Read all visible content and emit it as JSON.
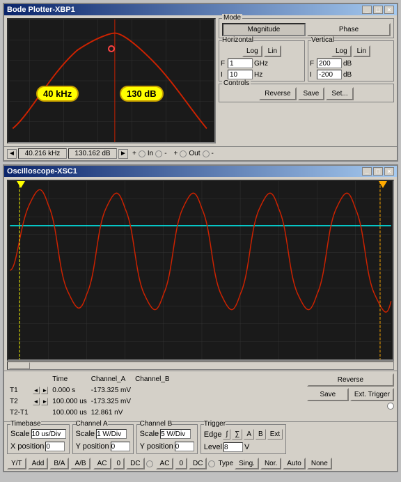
{
  "bode": {
    "title": "Bode Plotter-XBP1",
    "labels": {
      "freq": "40 kHz",
      "db": "130 dB"
    },
    "mode": {
      "label": "Mode",
      "magnitude": "Magnitude",
      "phase": "Phase"
    },
    "horizontal": {
      "label": "Horizontal",
      "log": "Log",
      "lin": "Lin",
      "f_label": "F",
      "f_value": "1",
      "f_unit": "GHz",
      "i_label": "I",
      "i_value": "10",
      "i_unit": "Hz"
    },
    "vertical": {
      "label": "Vertical",
      "log": "Log",
      "lin": "Lin",
      "f_label": "F",
      "f_value": "200",
      "f_unit": "dB",
      "i_label": "I",
      "i_value": "-200",
      "i_unit": "dB"
    },
    "controls": {
      "label": "Controls",
      "reverse": "Reverse",
      "save": "Save",
      "set": "Set..."
    },
    "status": {
      "freq": "40.216 kHz",
      "db": "130.162 dB",
      "in_label": "+ C In C -",
      "out_label": "+ C Out C -"
    }
  },
  "osc": {
    "title": "Oscilloscope-XSC1",
    "measurements": {
      "t1_label": "T1",
      "t2_label": "T2",
      "t2t1_label": "T2-T1",
      "time_header": "Time",
      "cha_header": "Channel_A",
      "chb_header": "Channel_B",
      "t1_time": "0.000 s",
      "t1_cha": "-173.325 mV",
      "t2_time": "100.000 us",
      "t2_cha": "-173.325 mV",
      "t2t1_time": "100.000 us",
      "t2t1_cha": "12.861 nV"
    },
    "buttons": {
      "reverse": "Reverse",
      "save": "Save",
      "ext_trigger": "Ext. Trigger"
    },
    "timebase": {
      "label": "Timebase",
      "scale_label": "Scale",
      "scale_value": "10 us/Div",
      "xpos_label": "X position",
      "xpos_value": "0"
    },
    "channel_a": {
      "label": "Channel A",
      "scale_label": "Scale",
      "scale_value": "1 W/Div",
      "ypos_label": "Y position",
      "ypos_value": "0"
    },
    "channel_b": {
      "label": "Channel B",
      "scale_label": "Scale",
      "scale_value": "5 W/Div",
      "ypos_label": "Y position",
      "ypos_value": "0"
    },
    "trigger": {
      "label": "Trigger",
      "edge_label": "Edge",
      "level_label": "Level",
      "level_value": "8",
      "level_unit": "V"
    },
    "bottom_btns": {
      "yt": "Y/T",
      "add": "Add",
      "ba": "B/A",
      "ab": "A/B",
      "ac0": "AC",
      "zero_a": "0",
      "dc_a": "DC",
      "ac_b": "AC",
      "zero_b": "0",
      "dc_b": "DC",
      "sing": "Sing.",
      "nor": "Nor.",
      "auto": "Auto",
      "none": "None"
    }
  }
}
